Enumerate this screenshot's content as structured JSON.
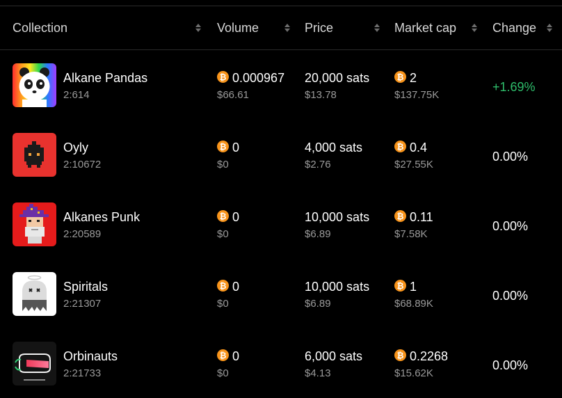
{
  "header": {
    "collection": "Collection",
    "volume": "Volume",
    "price": "Price",
    "market_cap": "Market cap",
    "change": "Change"
  },
  "icons": {
    "sort": "sort-arrows-icon",
    "currency": "bitcoin-icon"
  },
  "colors": {
    "background": "#000000",
    "positive": "#2ebd6b",
    "neutral": "#ffffff",
    "bitcoin": "#f7931a",
    "muted": "#9a9a9a"
  },
  "rows": [
    {
      "name": "Alkane Pandas",
      "id": "2:614",
      "volume_btc": "0.000967",
      "volume_usd": "$66.61",
      "price": "20,000 sats",
      "price_usd": "$13.78",
      "mcap_btc": "2",
      "mcap_usd": "$137.75K",
      "change": "+1.69%",
      "change_color": "#2ebd6b",
      "thumb": "panda-thumbnail"
    },
    {
      "name": "Oyly",
      "id": "2:10672",
      "volume_btc": "0",
      "volume_usd": "$0",
      "price": "4,000 sats",
      "price_usd": "$2.76",
      "mcap_btc": "0.4",
      "mcap_usd": "$27.55K",
      "change": "0.00%",
      "change_color": "#ffffff",
      "thumb": "oyly-thumbnail"
    },
    {
      "name": "Alkanes Punk",
      "id": "2:20589",
      "volume_btc": "0",
      "volume_usd": "$0",
      "price": "10,000 sats",
      "price_usd": "$6.89",
      "mcap_btc": "0.11",
      "mcap_usd": "$7.58K",
      "change": "0.00%",
      "change_color": "#ffffff",
      "thumb": "punk-thumbnail"
    },
    {
      "name": "Spiritals",
      "id": "2:21307",
      "volume_btc": "0",
      "volume_usd": "$0",
      "price": "10,000 sats",
      "price_usd": "$6.89",
      "mcap_btc": "1",
      "mcap_usd": "$68.89K",
      "change": "0.00%",
      "change_color": "#ffffff",
      "thumb": "ghost-thumbnail"
    },
    {
      "name": "Orbinauts",
      "id": "2:21733",
      "volume_btc": "0",
      "volume_usd": "$0",
      "price": "6,000 sats",
      "price_usd": "$4.13",
      "mcap_btc": "0.2268",
      "mcap_usd": "$15.62K",
      "change": "0.00%",
      "change_color": "#ffffff",
      "thumb": "orbinauts-thumbnail"
    }
  ]
}
